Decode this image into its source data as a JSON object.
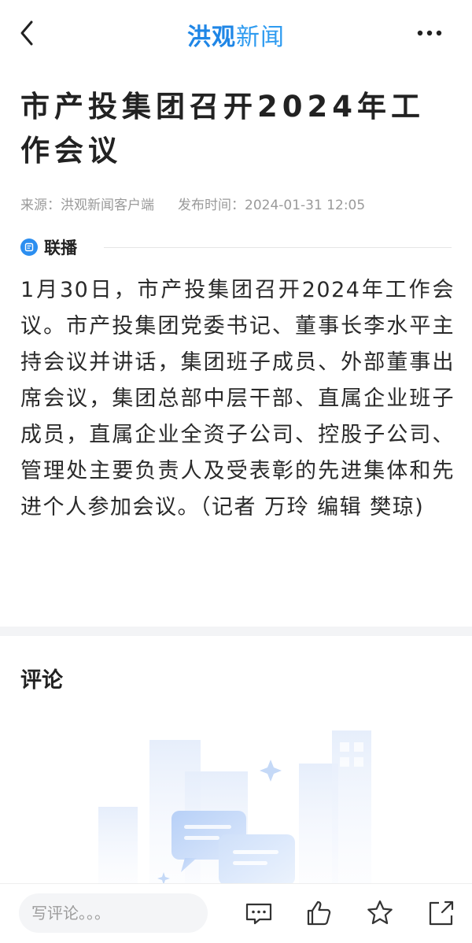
{
  "header": {
    "logo_main": "洪观",
    "logo_sub": "新闻",
    "icons": {
      "back": "chevron-left-icon",
      "more": "more-horizontal-icon"
    }
  },
  "article": {
    "title": "市产投集团召开2024年工作会议",
    "source": "来源：洪观新闻客户端",
    "publish_time": "发布时间：2024-01-31 12:05",
    "section_label": "联播",
    "body": "1月30日，市产投集团召开2024年工作会议。市产投集团党委书记、董事长李水平主持会议并讲话，集团班子成员、外部董事出席会议，集团总部中层干部、直属企业班子成员，直属企业全资子公司、控股子公司、管理处主要负责人及受表彰的先进集体和先进个人参加会议。（记者 万玲 编辑 樊琼)"
  },
  "comments": {
    "title": "评论",
    "input_placeholder": "写评论。。。"
  },
  "bottom_bar": {
    "icons": [
      "comment-icon",
      "thumbs-up-icon",
      "star-icon",
      "share-icon"
    ]
  },
  "colors": {
    "brand": "#1f86e6",
    "accent": "#2b8ef0",
    "muted": "#9a9a9a"
  }
}
